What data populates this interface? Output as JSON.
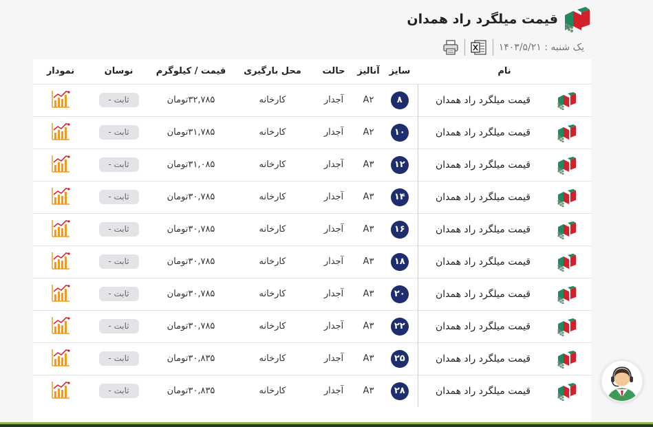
{
  "header": {
    "title": "قیمت میلگرد راد همدان",
    "date": "یک شنبه : ۱۴۰۳/۵/۲۱",
    "excel_icon": "excel-icon",
    "print_icon": "print-icon"
  },
  "table": {
    "columns": {
      "name": "نام",
      "size": "سایز",
      "analysis": "آنالیز",
      "state": "حالت",
      "place": "محل بارگیری",
      "price": "قیمت / کیلوگرم",
      "change": "نوسان",
      "chart": "نمودار"
    },
    "rows": [
      {
        "name": "قیمت میلگرد راد همدان",
        "size": "۸",
        "analysis": "A۲",
        "state": "آجدار",
        "place": "کارخانه",
        "price": "۳۲,۷۸۵تومان",
        "change": "ثابت -"
      },
      {
        "name": "قیمت میلگرد راد همدان",
        "size": "۱۰",
        "analysis": "A۲",
        "state": "آجدار",
        "place": "کارخانه",
        "price": "۳۱,۷۸۵تومان",
        "change": "ثابت -"
      },
      {
        "name": "قیمت میلگرد راد همدان",
        "size": "۱۲",
        "analysis": "A۳",
        "state": "آجدار",
        "place": "کارخانه",
        "price": "۳۱,۰۸۵تومان",
        "change": "ثابت -"
      },
      {
        "name": "قیمت میلگرد راد همدان",
        "size": "۱۴",
        "analysis": "A۳",
        "state": "آجدار",
        "place": "کارخانه",
        "price": "۳۰,۷۸۵تومان",
        "change": "ثابت -"
      },
      {
        "name": "قیمت میلگرد راد همدان",
        "size": "۱۶",
        "analysis": "A۳",
        "state": "آجدار",
        "place": "کارخانه",
        "price": "۳۰,۷۸۵تومان",
        "change": "ثابت -"
      },
      {
        "name": "قیمت میلگرد راد همدان",
        "size": "۱۸",
        "analysis": "A۳",
        "state": "آجدار",
        "place": "کارخانه",
        "price": "۳۰,۷۸۵تومان",
        "change": "ثابت -"
      },
      {
        "name": "قیمت میلگرد راد همدان",
        "size": "۲۰",
        "analysis": "A۳",
        "state": "آجدار",
        "place": "کارخانه",
        "price": "۳۰,۷۸۵تومان",
        "change": "ثابت -"
      },
      {
        "name": "قیمت میلگرد راد همدان",
        "size": "۲۲",
        "analysis": "A۳",
        "state": "آجدار",
        "place": "کارخانه",
        "price": "۳۰,۷۸۵تومان",
        "change": "ثابت -"
      },
      {
        "name": "قیمت میلگرد راد همدان",
        "size": "۲۵",
        "analysis": "A۳",
        "state": "آجدار",
        "place": "کارخانه",
        "price": "۳۰,۸۳۵تومان",
        "change": "ثابت -"
      },
      {
        "name": "قیمت میلگرد راد همدان",
        "size": "۲۸",
        "analysis": "A۳",
        "state": "آجدار",
        "place": "کارخانه",
        "price": "۳۰,۸۳۵تومان",
        "change": "ثابت -"
      }
    ]
  },
  "colors": {
    "size_badge": "#1e2d6e",
    "change_badge": "#e3e4e8",
    "chart_orange": "#f39a1e",
    "logo_red": "#d4202a",
    "logo_green": "#1e8a5e"
  },
  "icons": {
    "row_logo": "brand-logo-icon",
    "chart": "bar-chart-icon",
    "support": "support-agent-icon"
  }
}
